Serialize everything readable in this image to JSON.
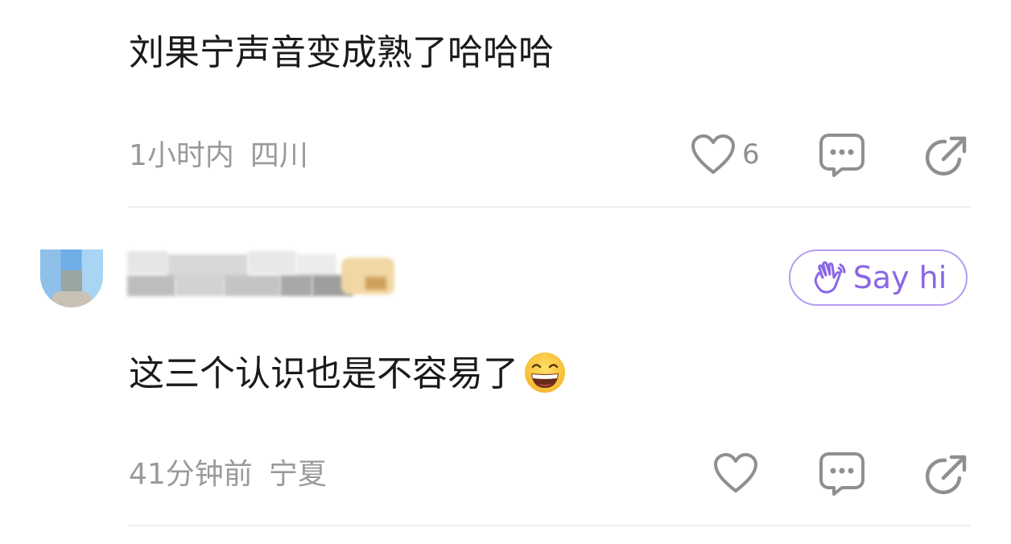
{
  "comments": [
    {
      "text": "刘果宁声音变成熟了哈哈哈",
      "time": "1小时内",
      "location": "四川",
      "likes": "6"
    },
    {
      "text": "这三个认识也是不容易了",
      "emoji": "grinning-face-emoji",
      "time": "41分钟前",
      "location": "宁夏",
      "likes": ""
    }
  ],
  "say_hi_label": "Say hi",
  "colors": {
    "text": "#1a1a1a",
    "meta": "#9a9a9a",
    "icon": "#8f8f8f",
    "say_hi": "#8a66e6",
    "say_hi_border": "#b59cf0",
    "divider": "#ededed"
  },
  "icons": {
    "like": "heart-icon",
    "reply": "comment-bubble-icon",
    "share": "share-arrow-icon",
    "wave": "waving-hand-icon"
  }
}
